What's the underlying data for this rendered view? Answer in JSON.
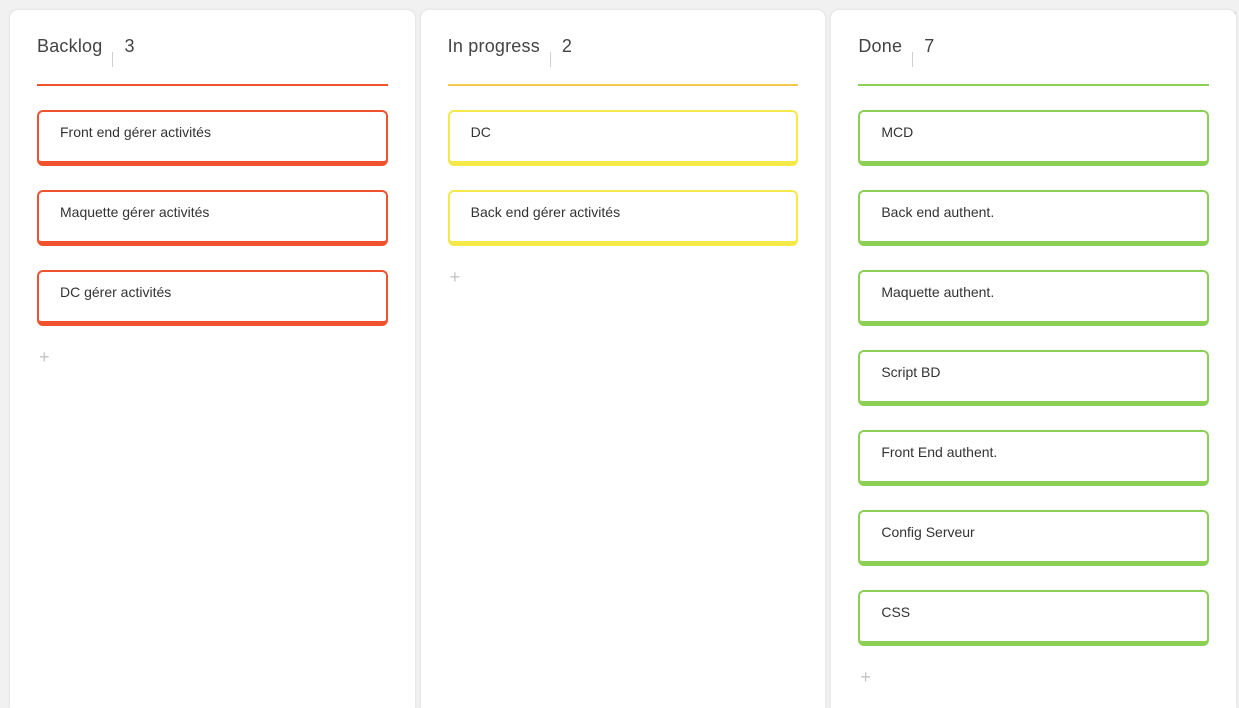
{
  "columns": [
    {
      "title": "Backlog",
      "count": "3",
      "color": "#f0522f",
      "cards": [
        "Front end gérer activités",
        "Maquette gérer activités",
        "DC gérer activités"
      ],
      "add_icon": "+"
    },
    {
      "title": "In progress",
      "count": "2",
      "color": "#f5e94a",
      "line_color": "#f2c94c",
      "cards": [
        "DC",
        "Back end gérer activités"
      ],
      "add_icon": "+"
    },
    {
      "title": "Done",
      "count": "7",
      "color": "#8ccf55",
      "cards": [
        "MCD",
        "Back end authent.",
        "Maquette authent.",
        "Script BD",
        "Front End authent.",
        "Config Serveur",
        "CSS"
      ],
      "add_icon": "+"
    }
  ]
}
